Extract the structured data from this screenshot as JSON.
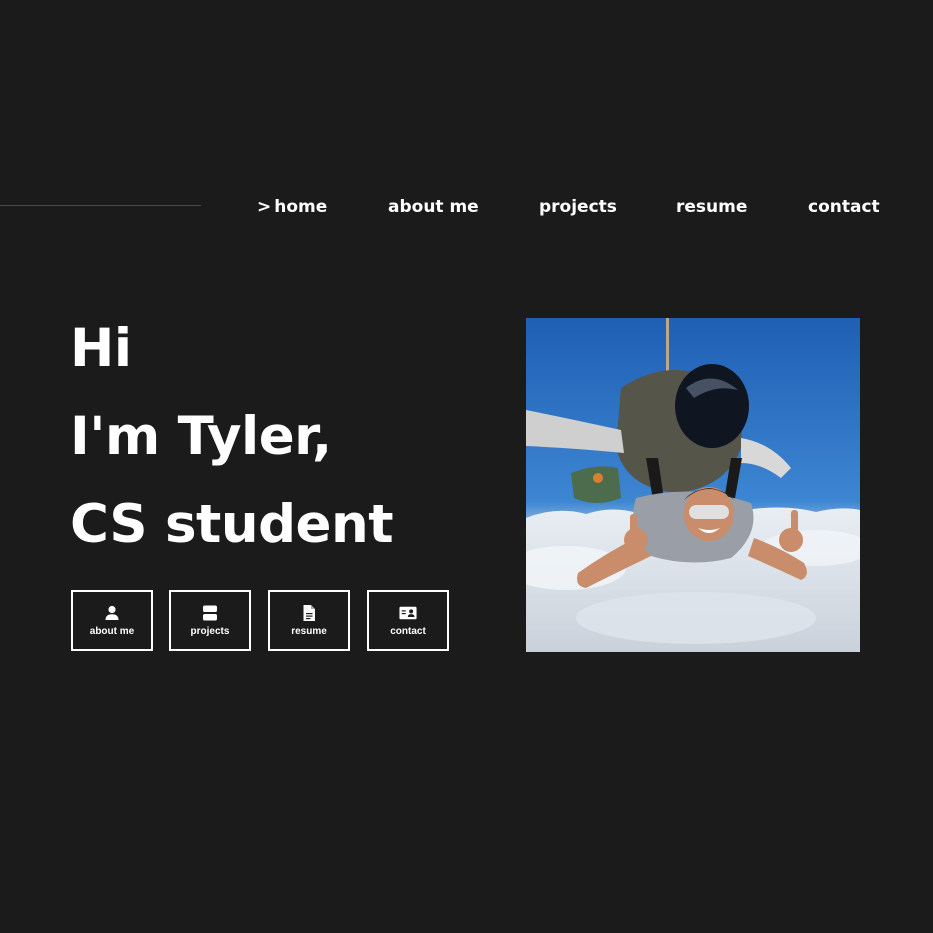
{
  "nav": {
    "active_prefix": ">",
    "items": [
      {
        "label": "home"
      },
      {
        "label": "about me"
      },
      {
        "label": "projects"
      },
      {
        "label": "resume"
      },
      {
        "label": "contact"
      }
    ]
  },
  "hero": {
    "line1": "Hi",
    "line2": "I'm Tyler,",
    "line3": "CS student"
  },
  "quick_links": [
    {
      "label": "about me",
      "icon": "person-icon"
    },
    {
      "label": "projects",
      "icon": "stack-icon"
    },
    {
      "label": "resume",
      "icon": "document-icon"
    },
    {
      "label": "contact",
      "icon": "contact-card-icon"
    }
  ],
  "colors": {
    "background": "#1b1b1c",
    "text": "#ffffff",
    "nav_line": "#4a4a4a"
  }
}
